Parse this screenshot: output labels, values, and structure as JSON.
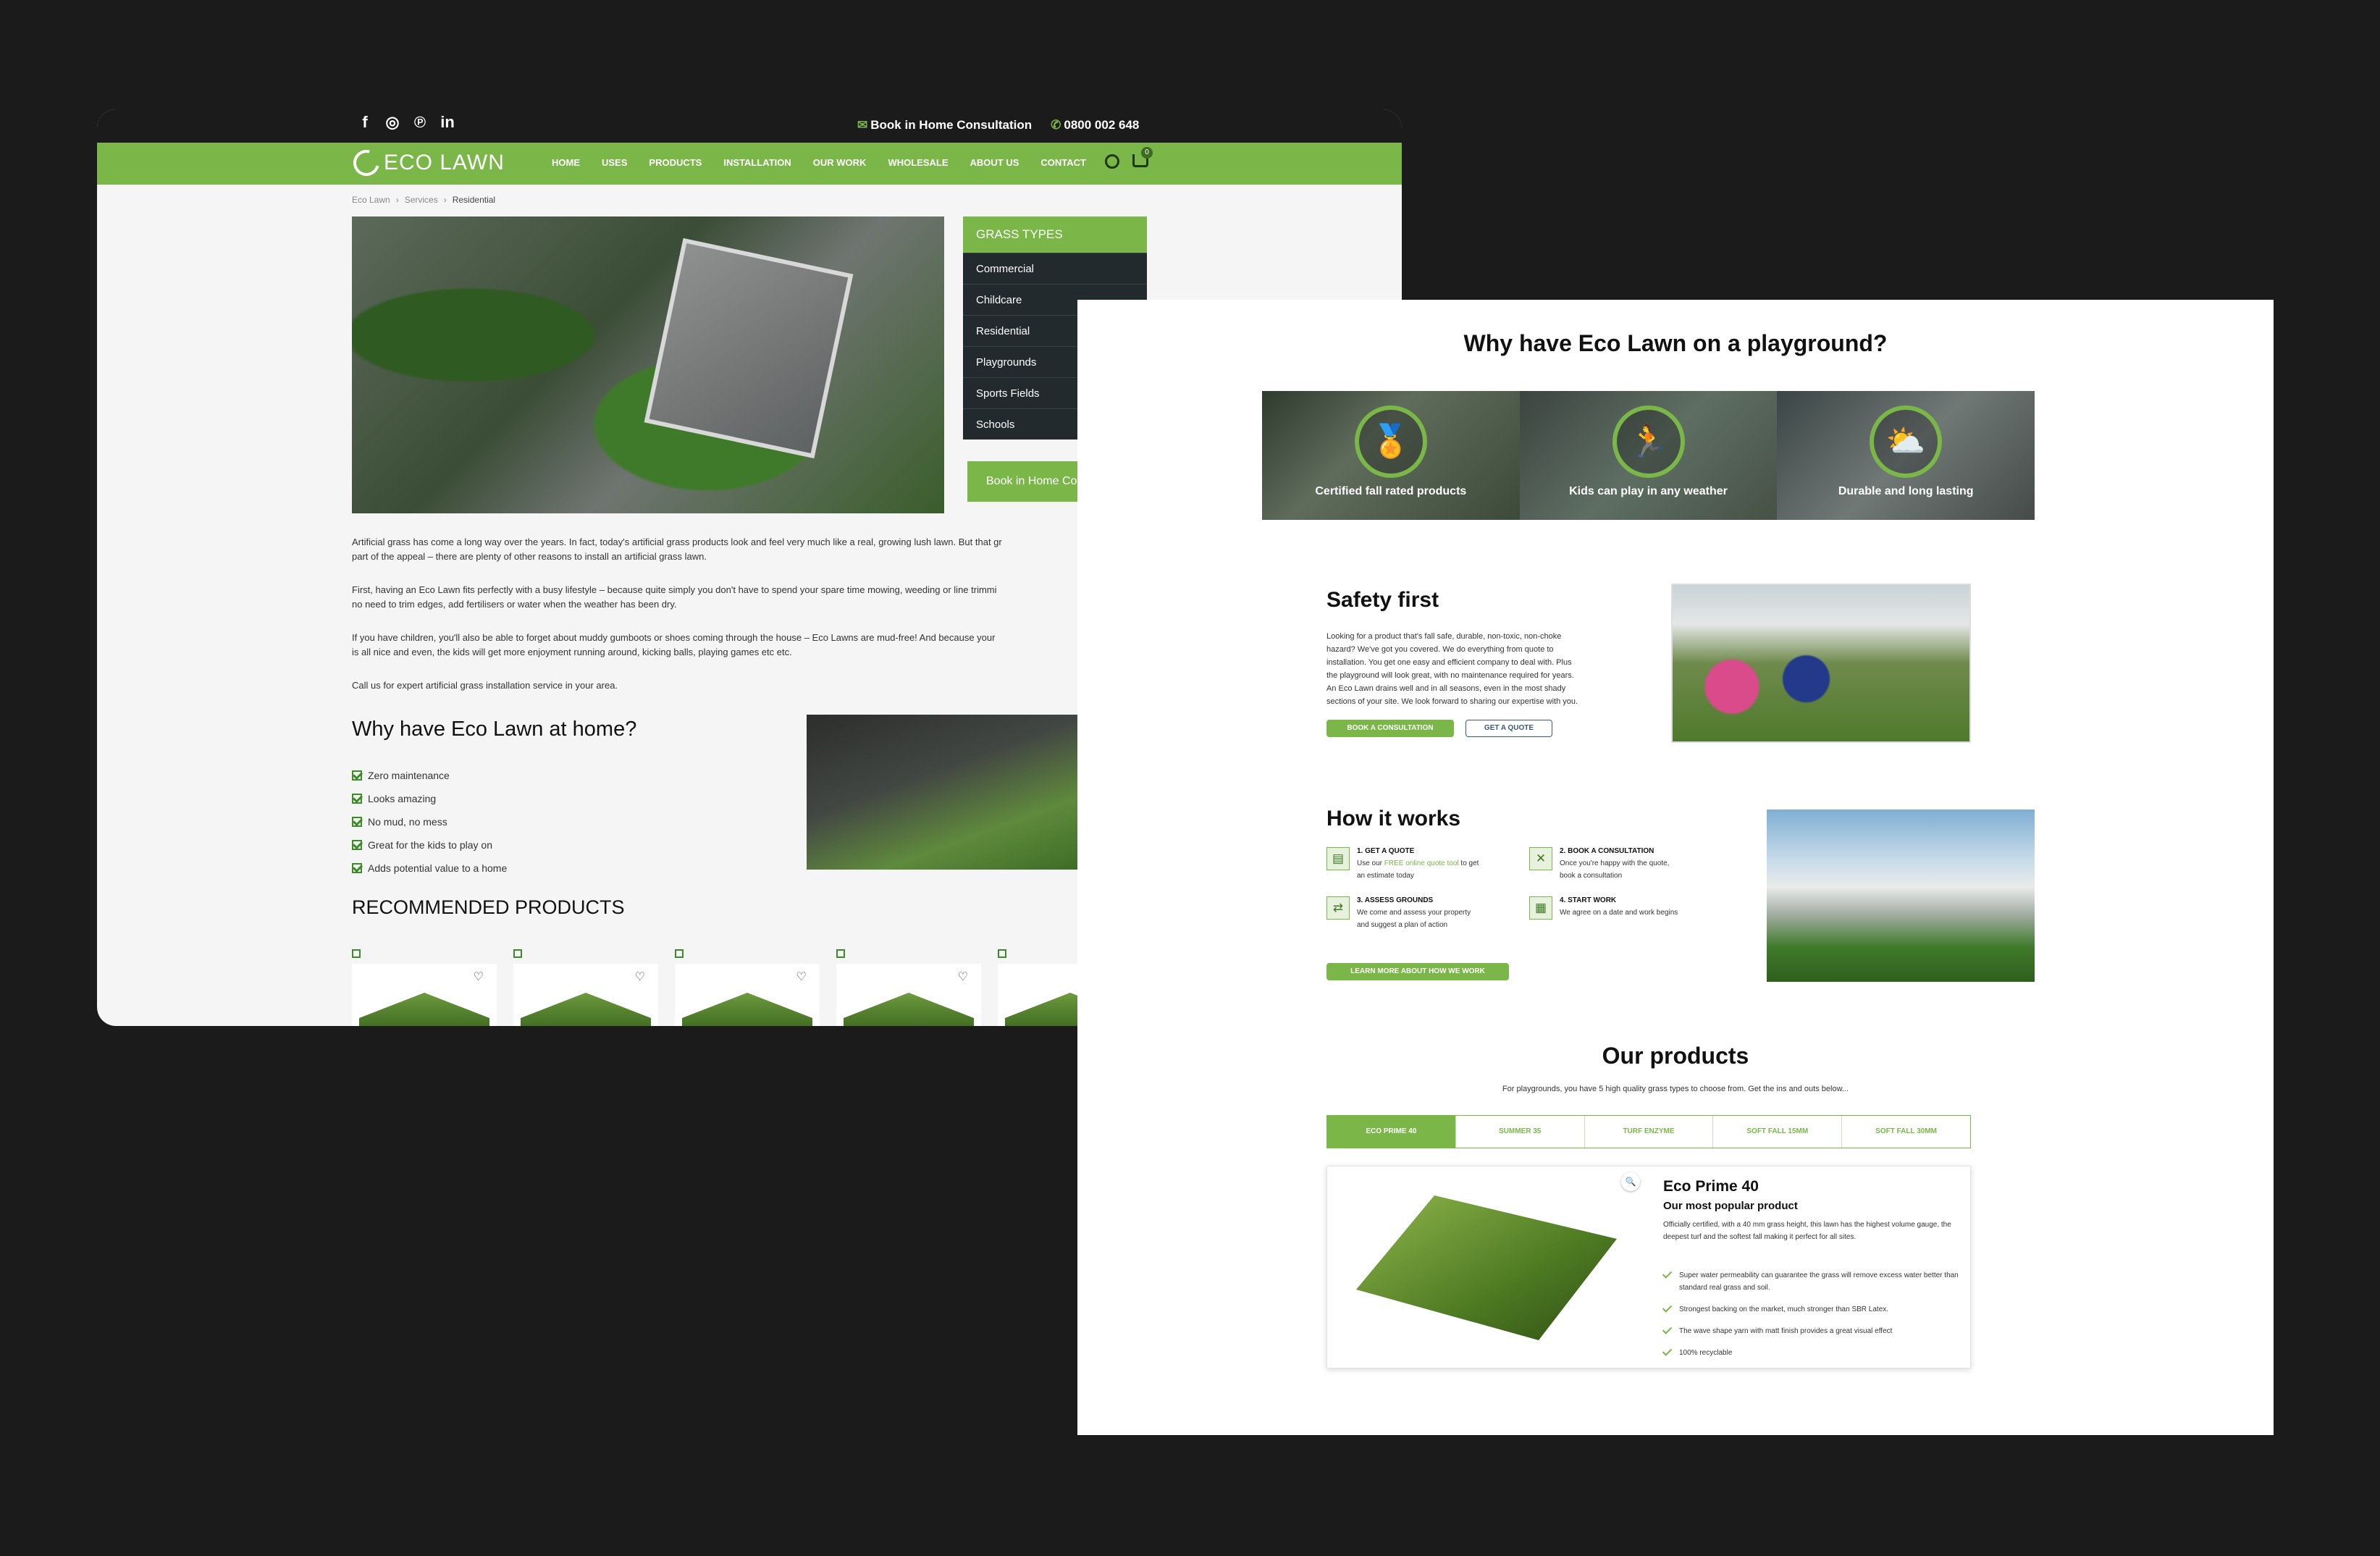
{
  "left": {
    "social_icons": [
      "facebook-icon",
      "instagram-icon",
      "pinterest-icon",
      "linkedin-icon"
    ],
    "topbar": {
      "consultation": "Book in Home Consultation",
      "phone": "0800 002 648"
    },
    "logo_text": "ECO LAWN",
    "nav": [
      "HOME",
      "USES",
      "PRODUCTS",
      "INSTALLATION",
      "OUR WORK",
      "WHOLESALE",
      "ABOUT US",
      "CONTACT"
    ],
    "cart_count": "0",
    "breadcrumb": [
      "Eco Lawn",
      "Services",
      "Residential"
    ],
    "grass_types": {
      "heading": "GRASS TYPES",
      "items": [
        "Commercial",
        "Childcare",
        "Residential",
        "Playgrounds",
        "Sports Fields",
        "Schools"
      ],
      "button": "Book in Home Co"
    },
    "paragraphs": [
      "Artificial grass has come a long way over the years. In fact, today's artificial grass products look and feel very much like a real, growing lush lawn. But that gr",
      "part of the appeal – there are plenty of other reasons to install an artificial grass lawn.",
      "First, having an Eco Lawn fits perfectly with a busy lifestyle – because quite simply you don't have to spend your spare time mowing, weeding or line trimmi",
      "no need to trim edges, add fertilisers or water when the weather has been dry.",
      "If you have children, you'll also be able to forget about muddy gumboots or shoes coming through the house – Eco Lawns are mud-free! And because your",
      "is all nice and even, the kids will get more enjoyment running around, kicking balls, playing games etc etc.",
      "Call us for expert artificial grass installation service in your area."
    ],
    "home_heading": "Why have Eco Lawn at home?",
    "home_list": [
      "Zero maintenance",
      "Looks amazing",
      "No mud, no mess",
      "Great for the kids to play on",
      "Adds potential value to a home"
    ],
    "recommended_heading": "RECOMMENDED PRODUCTS"
  },
  "right": {
    "title": "Why have Eco Lawn on a playground?",
    "features": [
      {
        "label": "Certified fall rated products",
        "icon": "medal-icon"
      },
      {
        "label": "Kids can play in any weather",
        "icon": "running-child-icon"
      },
      {
        "label": "Durable and long lasting",
        "icon": "weather-icon"
      }
    ],
    "safety": {
      "heading": "Safety first",
      "lines": [
        "Looking for a product that's fall safe, durable, non-toxic, non-choke",
        "hazard? We've got you covered. We do everything from quote to",
        "installation. You get one easy and efficient company to deal with. Plus",
        "the playground will look great, with no maintenance required for years.",
        "An Eco Lawn drains well and in all seasons, even in the most shady",
        "sections of your site. We look forward to sharing our expertise with you."
      ],
      "btn_primary": "BOOK A CONSULTATION",
      "btn_secondary": "GET A QUOTE"
    },
    "how": {
      "heading": "How it works",
      "steps": [
        {
          "title": "1. GET A QUOTE",
          "line1_pre": "Use our ",
          "line1_link": "FREE online quote tool",
          "line1_post": " to get",
          "line2": "an estimate today"
        },
        {
          "title": "2. BOOK A CONSULTATION",
          "line1_pre": "Once you're happy with the quote,",
          "line1_link": "",
          "line1_post": "",
          "line2": "book a consultation"
        },
        {
          "title": "3. ASSESS GROUNDS",
          "line1_pre": "We come and assess your property",
          "line1_link": "",
          "line1_post": "",
          "line2": "and suggest a plan of action"
        },
        {
          "title": "4. START WORK",
          "line1_pre": "We agree on a date and work begins",
          "line1_link": "",
          "line1_post": "",
          "line2": ""
        }
      ],
      "button": "LEARN MORE ABOUT HOW WE WORK"
    },
    "products": {
      "heading": "Our products",
      "subtitle": "For playgrounds, you have 5 high quality grass types to choose from. Get the ins and outs below...",
      "tabs": [
        "ECO PRIME 40",
        "SUMMER 35",
        "TURF ENZYME",
        "SOFT FALL 15MM",
        "SOFT FALL 30MM"
      ],
      "active_tab": 0,
      "card": {
        "title": "Eco Prime 40",
        "subtitle": "Our most popular product",
        "description": "Officially certified, with a 40 mm grass height, this lawn has the highest volume gauge, the deepest turf and the softest fall making it perfect for all sites.",
        "features": [
          "Super water permeability can guarantee the grass will remove excess water better than standard real grass and soil.",
          "Strongest backing on the market, much stronger than SBR Latex.",
          "The wave shape yarn with matt finish provides a great visual effect",
          "100% recyclable"
        ]
      }
    }
  },
  "colors": {
    "brand_green": "#7ab648",
    "dark": "#1b1b1b",
    "menu_dark": "#232a2e"
  }
}
